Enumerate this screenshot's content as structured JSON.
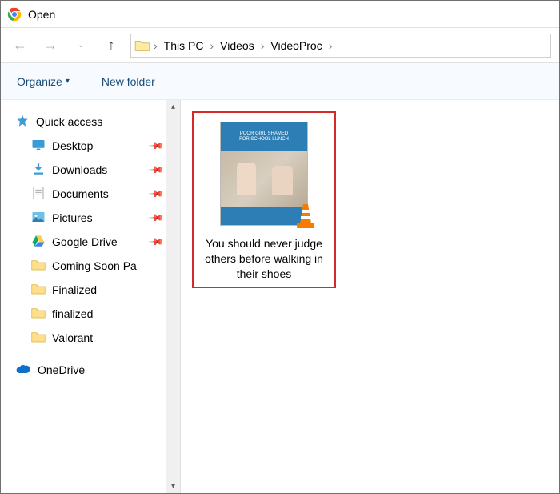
{
  "title": "Open",
  "breadcrumb": [
    "This PC",
    "Videos",
    "VideoProc"
  ],
  "toolbar": {
    "organize": "Organize",
    "newfolder": "New folder"
  },
  "sidebar": {
    "quick_access": "Quick access",
    "items": [
      {
        "label": "Desktop",
        "pinned": true
      },
      {
        "label": "Downloads",
        "pinned": true
      },
      {
        "label": "Documents",
        "pinned": true
      },
      {
        "label": "Pictures",
        "pinned": true
      },
      {
        "label": "Google Drive",
        "pinned": true
      },
      {
        "label": "Coming Soon Pa",
        "pinned": false
      },
      {
        "label": "Finalized",
        "pinned": false
      },
      {
        "label": "finalized",
        "pinned": false
      },
      {
        "label": "Valorant",
        "pinned": false
      }
    ],
    "onedrive": "OneDrive"
  },
  "file": {
    "name": "You should never judge others before walking in their shoes",
    "thumb_banner_top": "POOR GIRL SHAMED",
    "thumb_banner_bottom": "FOR SCHOOL LUNCH"
  }
}
